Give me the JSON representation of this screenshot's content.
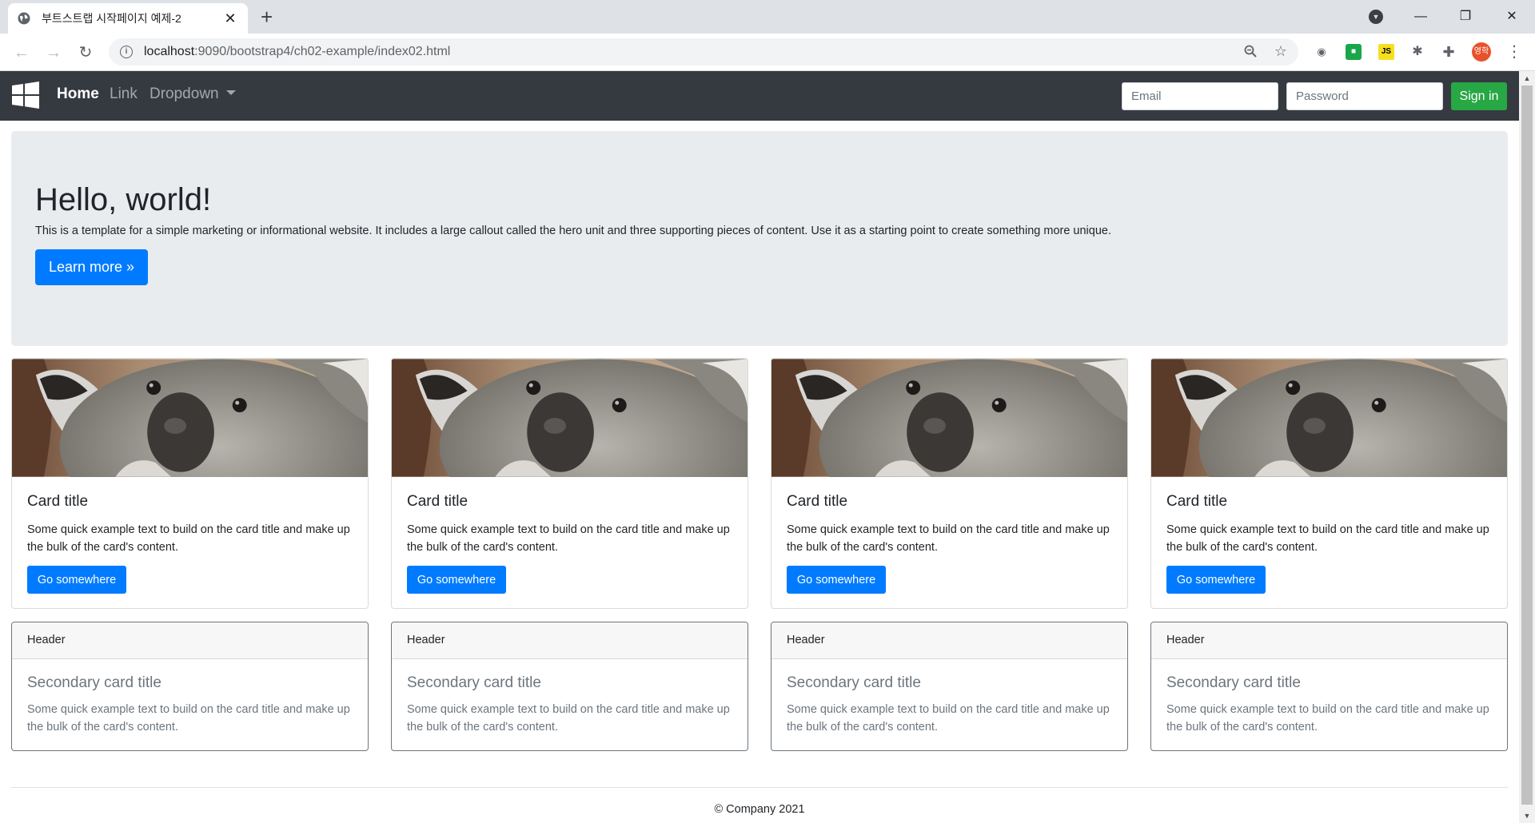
{
  "browser": {
    "tab_title": "부트스트랩 시작페이지 예제-2",
    "tab_close": "✕",
    "new_tab": "+",
    "url_host": "localhost",
    "url_path": ":9090/bootstrap4/ch02-example/index02.html",
    "window_controls": [
      "—",
      "❐",
      "✕"
    ],
    "profile_label": "영학",
    "extensions": [
      "ghost-icon",
      "green-ext-icon",
      "js-icon",
      "bug-icon",
      "puzzle-icon"
    ],
    "ext_js_label": "JS"
  },
  "navbar": {
    "links": [
      {
        "label": "Home",
        "active": true
      },
      {
        "label": "Link",
        "active": false
      },
      {
        "label": "Dropdown",
        "active": false
      }
    ],
    "email_placeholder": "Email",
    "password_placeholder": "Password",
    "signin_label": "Sign in"
  },
  "jumbotron": {
    "heading": "Hello, world!",
    "text": "This is a template for a simple marketing or informational website. It includes a large callout called the hero unit and three supporting pieces of content. Use it as a starting point to create something more unique.",
    "button_label": "Learn more »"
  },
  "cards": [
    {
      "title": "Card title",
      "text": "Some quick example text to build on the card title and make up the bulk of the card's content.",
      "button": "Go somewhere"
    },
    {
      "title": "Card title",
      "text": "Some quick example text to build on the card title and make up the bulk of the card's content.",
      "button": "Go somewhere"
    },
    {
      "title": "Card title",
      "text": "Some quick example text to build on the card title and make up the bulk of the card's content.",
      "button": "Go somewhere"
    },
    {
      "title": "Card title",
      "text": "Some quick example text to build on the card title and make up the bulk of the card's content.",
      "button": "Go somewhere"
    }
  ],
  "secondary_cards": [
    {
      "header": "Header",
      "title": "Secondary card title",
      "text": "Some quick example text to build on the card title and make up the bulk of the card's content."
    },
    {
      "header": "Header",
      "title": "Secondary card title",
      "text": "Some quick example text to build on the card title and make up the bulk of the card's content."
    },
    {
      "header": "Header",
      "title": "Secondary card title",
      "text": "Some quick example text to build on the card title and make up the bulk of the card's content."
    },
    {
      "header": "Header",
      "title": "Secondary card title",
      "text": "Some quick example text to build on the card title and make up the bulk of the card's content."
    }
  ],
  "footer": {
    "text": "© Company 2021"
  },
  "colors": {
    "navbar_bg": "#343a40",
    "primary": "#007bff",
    "success": "#28a745",
    "jumbotron_bg": "#e9ecef",
    "secondary": "#6c757d"
  }
}
